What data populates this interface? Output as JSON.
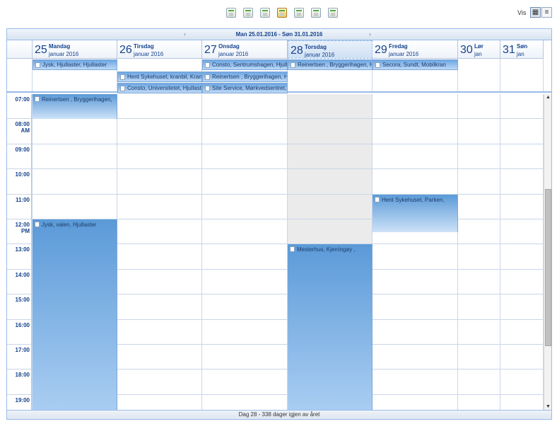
{
  "toolbar": {
    "view_buttons": [
      {
        "name": "day"
      },
      {
        "name": "days"
      },
      {
        "name": "workweek"
      },
      {
        "name": "week",
        "active": true
      },
      {
        "name": "twoweeks"
      },
      {
        "name": "month"
      },
      {
        "name": "year"
      }
    ],
    "vis_label": "Vis",
    "mode_calendar_icon": "calendar-view-icon",
    "mode_list_icon": "list-view-icon"
  },
  "nav": {
    "range_label": "Man 25.01.2016 - Søn 31.01.2016",
    "prev_icon": "‹",
    "next_icon": "›"
  },
  "days": [
    {
      "num": "25",
      "name": "Mandag",
      "month": "januar 2016"
    },
    {
      "num": "26",
      "name": "Tirsdag",
      "month": "januar 2016"
    },
    {
      "num": "27",
      "name": "Onsdag",
      "month": "januar 2016"
    },
    {
      "num": "28",
      "name": "Torsdag",
      "month": "januar 2016",
      "today": true
    },
    {
      "num": "29",
      "name": "Fredag",
      "month": "januar 2016"
    },
    {
      "num": "30",
      "name": "Lør",
      "month": "jan"
    },
    {
      "num": "31",
      "name": "Søn",
      "month": "jan"
    }
  ],
  "allday_events": [
    {
      "day": 0,
      "row": 0,
      "span": 1,
      "label": "Jysk, Hjullaster, Hjullaster"
    },
    {
      "day": 1,
      "row": 1,
      "span": 1,
      "label": "Hent Sykehuset, kranbil, Kranbil"
    },
    {
      "day": 1,
      "row": 2,
      "span": 1,
      "label": "Consto, Universitetet, Hjullaster"
    },
    {
      "day": 2,
      "row": 0,
      "span": 1,
      "label": "Consto, Sentrumshagen, Hjullaster"
    },
    {
      "day": 2,
      "row": 1,
      "span": 1,
      "label": "Reinertsen , Bryggerihagen, Hjullaster"
    },
    {
      "day": 2,
      "row": 2,
      "span": 1,
      "label": "Site Service, Mørkvedsentret, Hjullaster"
    },
    {
      "day": 3,
      "row": 0,
      "span": 1,
      "label": "Reinertsen , Bryggerihagen, Hjullaster"
    },
    {
      "day": 4,
      "row": 0,
      "span": 1,
      "label": "Secora, Sundt, Mobilkran"
    }
  ],
  "time_labels": [
    "07:00",
    "08:00 AM",
    "09:00",
    "10:00",
    "11:00",
    "12:00 PM",
    "13:00",
    "14:00",
    "15:00",
    "16:00",
    "17:00",
    "18:00",
    "19:00"
  ],
  "timed_events": [
    {
      "day": 0,
      "start": 7.0,
      "end": 8.0,
      "label": "Reinertsen , Bryggerihagen,"
    },
    {
      "day": 0,
      "start": 12.0,
      "end": 19.6,
      "label": "Jysk, valen, Hjullaster"
    },
    {
      "day": 4,
      "start": 11.0,
      "end": 12.5,
      "label": "Hent Sykehuset, Parken,"
    },
    {
      "day": 3,
      "start": 13.0,
      "end": 19.6,
      "label": "Mesterhus, Kjerringøy ,"
    }
  ],
  "status": "Dag 28 - 338 dager igjen av året"
}
